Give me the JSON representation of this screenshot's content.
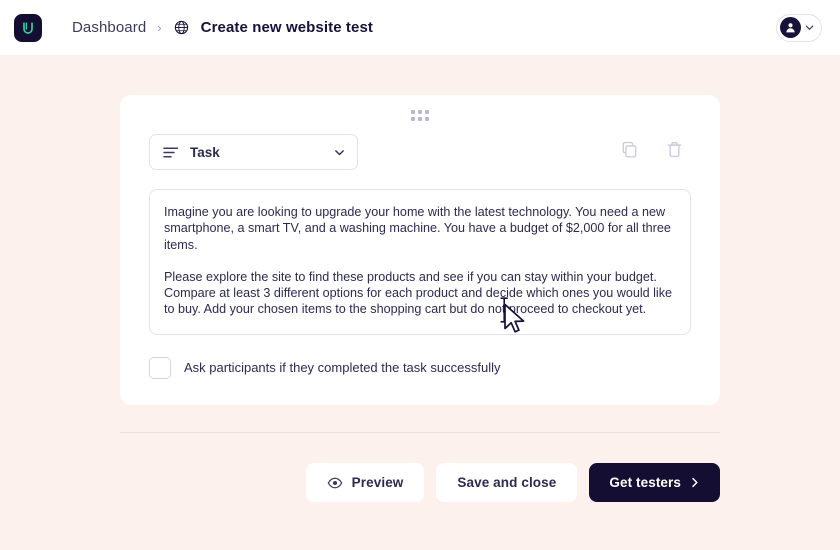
{
  "header": {
    "logo_icon": "userbrain-logo-icon",
    "breadcrumb": {
      "parent_label": "Dashboard",
      "separator": "›",
      "current_icon": "globe-icon",
      "current_label": "Create new website test"
    },
    "account": {
      "avatar_icon": "person-icon",
      "chevron_icon": "chevron-down-icon"
    }
  },
  "card": {
    "drag_handle_icon": "drag-dots-icon",
    "block_type_select": {
      "icon": "text-lines-icon",
      "value": "Task",
      "chevron_icon": "chevron-down-icon"
    },
    "actions": {
      "duplicate_icon": "copy-icon",
      "delete_icon": "trash-icon"
    },
    "task_text": {
      "paragraph_1": "Imagine you are looking to upgrade your home with the latest technology. You need a new smartphone, a smart TV, and a washing machine. You have a budget of $2,000 for all three items.",
      "paragraph_2": "Please explore the site to find these products and see if you can stay within your budget. Compare at least 3 different options for each product and decide which ones you would like to buy. Add your chosen items to the shopping cart but do not proceed to checkout yet."
    },
    "checkbox": {
      "checked": false,
      "label": "Ask participants if they completed the task successfully"
    }
  },
  "footer": {
    "preview_button": {
      "icon": "eye-icon",
      "label": "Preview"
    },
    "save_button": {
      "label": "Save and close"
    },
    "get_testers_button": {
      "label": "Get testers",
      "chevron_icon": "chevron-right-icon"
    }
  },
  "colors": {
    "page_background": "#fdf1ee",
    "header_background": "#ffffff",
    "card_background": "#ffffff",
    "brand_dark": "#140f32",
    "brand_accent": "#2ecfa0",
    "text_primary": "#2d2a50",
    "border": "#e4e2ec"
  }
}
